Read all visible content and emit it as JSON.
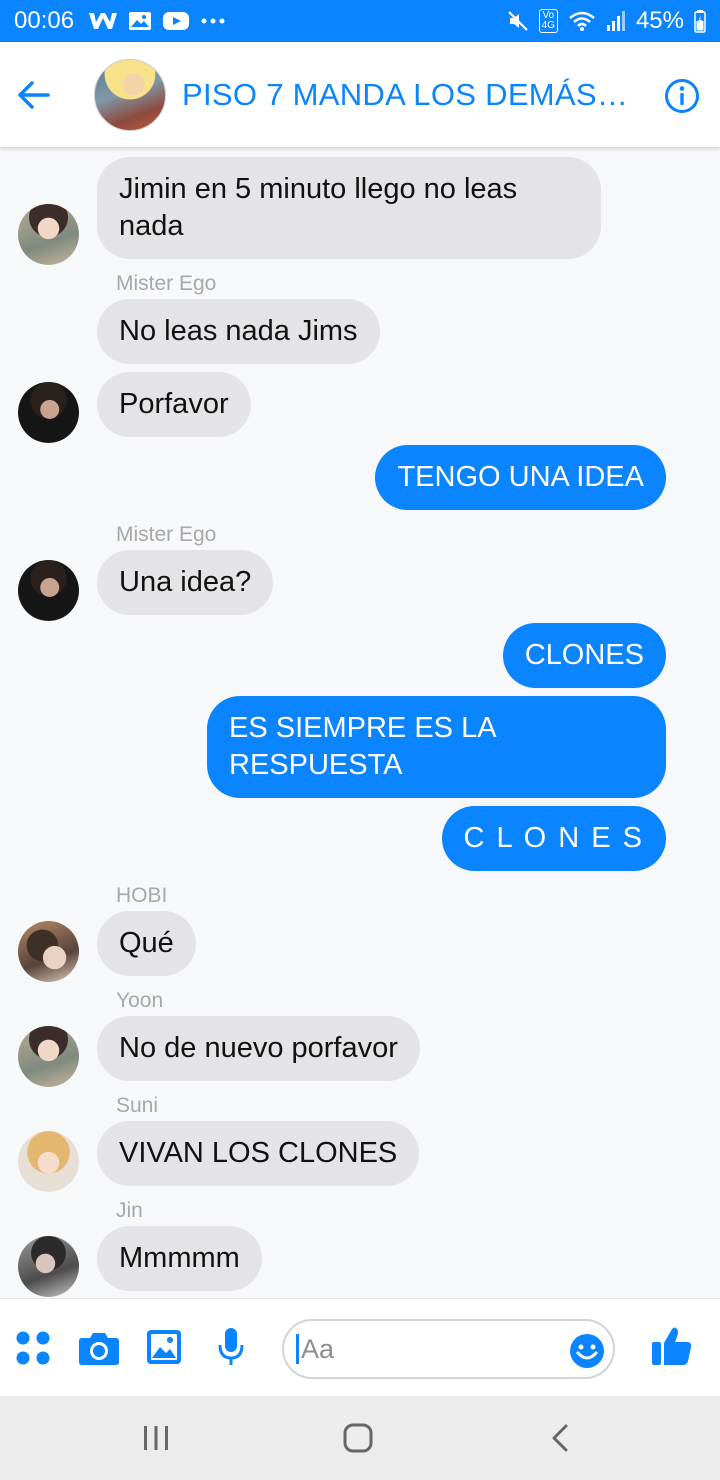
{
  "status_bar": {
    "time": "00:06",
    "left_icons": [
      "wattpad-icon",
      "gallery-icon",
      "youtube-icon",
      "more-dots-icon"
    ],
    "volte_label": "Vo)\n4G",
    "battery": "45%"
  },
  "header": {
    "title": "PISO 7 MANDA LOS DEMÁS…"
  },
  "messages": [
    {
      "id": "m1",
      "direction": "in",
      "sender": "",
      "text": "Jimin en 5 minuto llego no leas nada",
      "avatar": "yoon"
    },
    {
      "id": "m2",
      "direction": "in",
      "sender": "Mister Ego",
      "text": "No leas nada Jims",
      "avatar": ""
    },
    {
      "id": "m3",
      "direction": "in",
      "sender": "",
      "text": "Porfavor",
      "avatar": "ego"
    },
    {
      "id": "m4",
      "direction": "out",
      "text": "TENGO UNA IDEA"
    },
    {
      "id": "m5",
      "direction": "in",
      "sender": "Mister Ego",
      "text": "Una idea?",
      "avatar": "ego"
    },
    {
      "id": "m6",
      "direction": "out",
      "text": "CLONES"
    },
    {
      "id": "m7",
      "direction": "out",
      "text": "ES SIEMPRE ES LA RESPUESTA"
    },
    {
      "id": "m8",
      "direction": "out",
      "text": "C L O N E S"
    },
    {
      "id": "m9",
      "direction": "in",
      "sender": "HOBI",
      "text": "Qué",
      "avatar": "hobi"
    },
    {
      "id": "m10",
      "direction": "in",
      "sender": "Yoon",
      "text": "No de nuevo porfavor",
      "avatar": "yoon"
    },
    {
      "id": "m11",
      "direction": "in",
      "sender": "Suni",
      "text": "VIVAN LOS CLONES",
      "avatar": "suni"
    },
    {
      "id": "m12",
      "direction": "in",
      "sender": "Jin",
      "text": "Mmmmm",
      "avatar": "jin"
    }
  ],
  "composer": {
    "placeholder": "Aa",
    "tools": [
      "apps-icon",
      "camera-icon",
      "image-icon",
      "microphone-icon"
    ],
    "send_icon": "thumbs-up-icon"
  },
  "colors": {
    "accent": "#0a84ff",
    "incoming_bubble": "#e4e4e6",
    "sender_label": "#a8a8a8"
  }
}
